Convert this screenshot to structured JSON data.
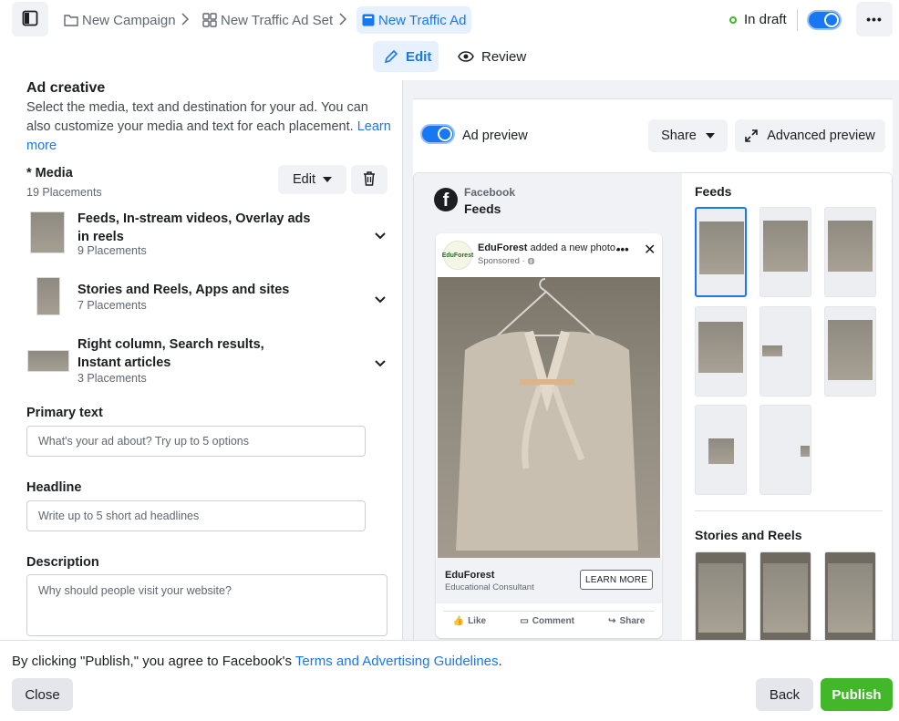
{
  "breadcrumb": {
    "campaign": "New Campaign",
    "ad_set": "New Traffic Ad Set",
    "ad": "New Traffic Ad"
  },
  "status": {
    "label": "In draft",
    "color": "#42b72a"
  },
  "tabs": {
    "edit": "Edit",
    "review": "Review"
  },
  "creative": {
    "title": "Ad creative",
    "description": "Select the media, text and destination for your ad. You can also customize your media and text for each placement. ",
    "learn_more": "Learn more"
  },
  "media": {
    "label": "* Media",
    "count": "19 Placements",
    "edit_label": "Edit",
    "placements": [
      {
        "name": "Feeds, In-stream videos, Overlay ads in reels",
        "count": "9 Placements"
      },
      {
        "name": "Stories and Reels, Apps and sites",
        "count": "7 Placements"
      },
      {
        "name": "Right column, Search results, Instant articles",
        "count": "3 Placements"
      }
    ]
  },
  "fields": {
    "primary_text": {
      "label": "Primary text",
      "placeholder": "What's your ad about? Try up to 5 options"
    },
    "headline": {
      "label": "Headline",
      "placeholder": "Write up to 5 short ad headlines"
    },
    "description": {
      "label": "Description",
      "placeholder": "Why should people visit your website?"
    }
  },
  "preview": {
    "toggle_label": "Ad preview",
    "share_label": "Share",
    "advanced_label": "Advanced preview",
    "platform": "Facebook",
    "placement": "Feeds",
    "post": {
      "page_name": "EduForest",
      "action_text": " added a new photo.",
      "sponsored": "Sponsored · ",
      "avatar_text": "EduForest",
      "brand": "EduForest",
      "subtitle": "Educational Consultant",
      "cta": "LEARN MORE",
      "like": "Like",
      "comment": "Comment",
      "share": "Share"
    },
    "sections": {
      "feeds": "Feeds",
      "stories": "Stories and Reels"
    }
  },
  "footer": {
    "terms_prefix": "By clicking \"Publish,\" you agree to Facebook's ",
    "terms_link": "Terms and Advertising Guidelines",
    "terms_suffix": ".",
    "close": "Close",
    "back": "Back",
    "publish": "Publish"
  },
  "colors": {
    "accent": "#1877f2",
    "publish": "#42b72a"
  }
}
